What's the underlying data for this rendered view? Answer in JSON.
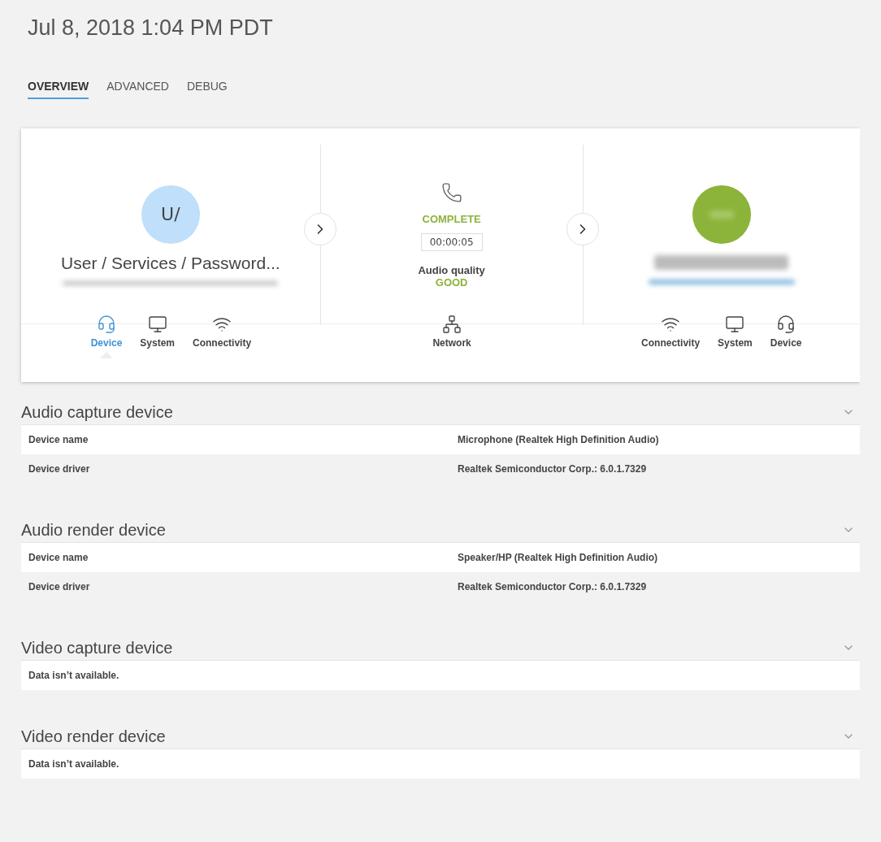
{
  "title": "Jul 8, 2018 1:04 PM PDT",
  "tabs": [
    {
      "label": "OVERVIEW",
      "selected": true
    },
    {
      "label": "ADVANCED",
      "selected": false
    },
    {
      "label": "DEBUG",
      "selected": false
    }
  ],
  "call": {
    "caller": {
      "avatar": "U/",
      "name": "User / Services / Password...",
      "nodes": [
        {
          "label": "Device",
          "kind": "headset",
          "selected": true
        },
        {
          "label": "System",
          "kind": "monitor",
          "selected": false
        },
        {
          "label": "Connectivity",
          "kind": "wifi",
          "selected": false
        }
      ]
    },
    "status": {
      "state": "COMPLETE",
      "duration": "00:00:05",
      "quality_label": "Audio quality",
      "quality": "GOOD",
      "nodes": [
        {
          "label": "Network",
          "kind": "network",
          "selected": false
        }
      ]
    },
    "callee": {
      "nodes": [
        {
          "label": "Connectivity",
          "kind": "wifi",
          "selected": false
        },
        {
          "label": "System",
          "kind": "monitor",
          "selected": false
        },
        {
          "label": "Device",
          "kind": "headset",
          "selected": false
        }
      ]
    }
  },
  "sections": [
    {
      "title": "Audio capture device",
      "rows": [
        {
          "kind": "pair",
          "label": "Device name",
          "value": "Microphone (Realtek High Definition Audio)"
        },
        {
          "kind": "pair",
          "label": "Device driver",
          "value": "Realtek Semiconductor Corp.: 6.0.1.7329"
        }
      ]
    },
    {
      "title": "Audio render device",
      "rows": [
        {
          "kind": "pair",
          "label": "Device name",
          "value": "Speaker/HP (Realtek High Definition Audio)"
        },
        {
          "kind": "pair",
          "label": "Device driver",
          "value": "Realtek Semiconductor Corp.: 6.0.1.7329"
        }
      ]
    },
    {
      "title": "Video capture device",
      "rows": [
        {
          "kind": "message",
          "text": "Data isn’t available."
        }
      ]
    },
    {
      "title": "Video render device",
      "rows": [
        {
          "kind": "message",
          "text": "Data isn’t available."
        }
      ]
    }
  ]
}
